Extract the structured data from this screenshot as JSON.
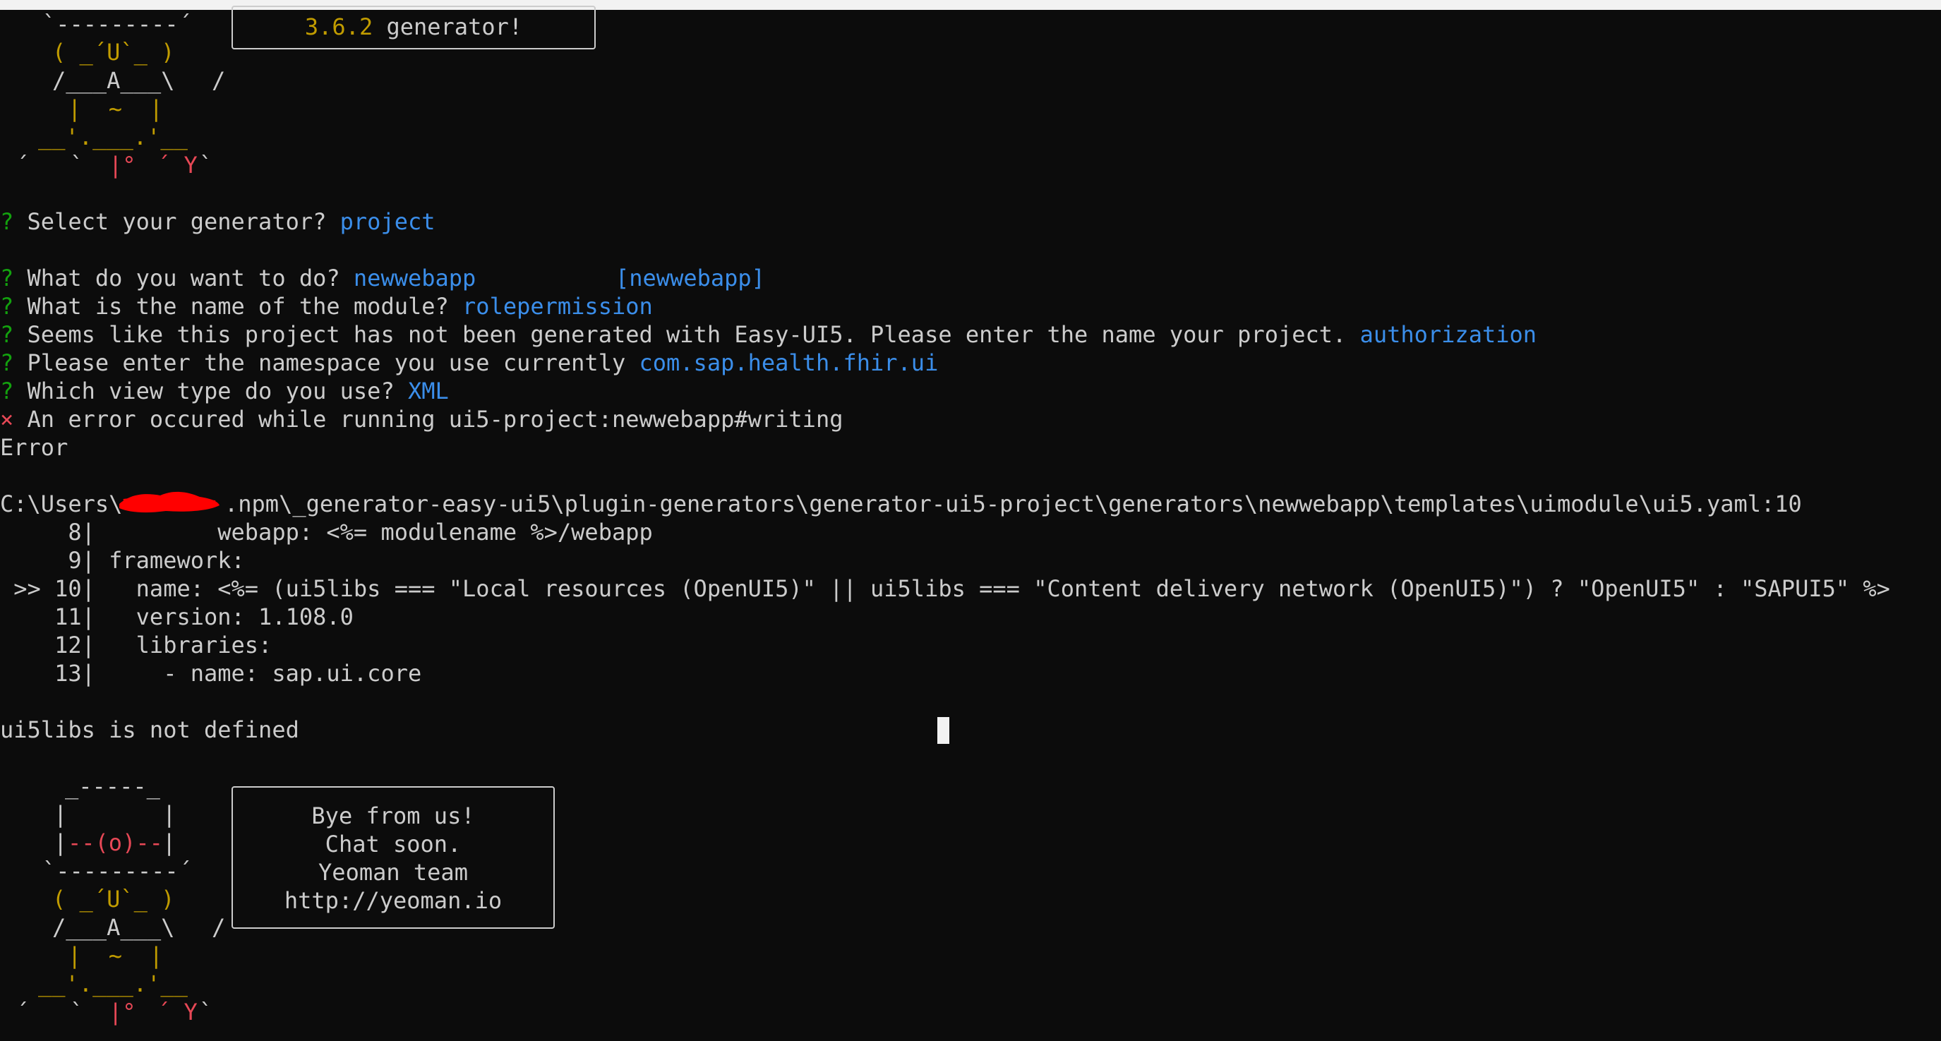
{
  "top_box": {
    "version": "3.6.2",
    "text": " generator!"
  },
  "yeoman_top": {
    "row1": "`---------´",
    "row2a": "( _´U`_ )",
    "row3a": "/___A___\\",
    "row3b": "/",
    "row4": "|  ~  |",
    "row5a": "__'.___.'__",
    "row6a": "´   `",
    "row6b": "|° ",
    "row6c": "´ Y ",
    "row6d": "`"
  },
  "prompts": [
    {
      "mark": "?",
      "question": " Select your generator? ",
      "answer": "project",
      "extra": ""
    },
    {
      "mark": "?",
      "question": " What do you want to do? ",
      "answer": "newwebapp",
      "extra": "[newwebapp]"
    },
    {
      "mark": "?",
      "question": " What is the name of the module? ",
      "answer": "rolepermission",
      "extra": ""
    },
    {
      "mark": "?",
      "question": " Seems like this project has not been generated with Easy-UI5. Please enter the name your project. ",
      "answer": "authorization",
      "extra": ""
    },
    {
      "mark": "?",
      "question": " Please enter the namespace you use currently ",
      "answer": "com.sap.health.fhir.ui",
      "extra": ""
    },
    {
      "mark": "?",
      "question": " Which view type do you use? ",
      "answer": "XML",
      "extra": ""
    }
  ],
  "error": {
    "mark": "×",
    "message": " An error occured while running ui5-project:newwebapp#writing",
    "label": "Error",
    "path_prefix": "C:\\Users\\",
    "path_rest": ".npm\\_generator-easy-ui5\\plugin-generators\\generator-ui5-project\\generators\\newwebapp\\templates\\uimodule\\ui5.yaml:10",
    "code_lines": [
      "     8|         webapp: <%= modulename %>/webapp",
      "     9| framework:",
      " >> 10|   name: <%= (ui5libs === \"Local resources (OpenUI5)\" || ui5libs === \"Content delivery network (OpenUI5)\") ? \"OpenUI5\" : \"SAPUI5\" %>",
      "    11|   version: 1.108.0",
      "    12|   libraries:",
      "    13|     - name: sap.ui.core"
    ],
    "detail": "ui5libs is not defined"
  },
  "yeoman_bottom": {
    "row0": "_-----_",
    "row1a": "|       |",
    "row2a": "|",
    "row2b": "--(o)--",
    "row2c": "|",
    "row3": "`---------´",
    "row4a": "( _´U`_ )",
    "row5a": "/___A___\\",
    "row5b": "/",
    "row6": "|  ~  |",
    "row7": "__'.___.'__",
    "row8a": "´   `",
    "row8b": "|° ",
    "row8c": "´ Y ",
    "row8d": "`"
  },
  "bye_box": {
    "line1": "Bye from us!",
    "line2": "Chat soon.",
    "line3": "Yeoman team",
    "line4": "http://yeoman.io"
  },
  "colors": {
    "background": "#0c0c0c",
    "text": "#cccccc",
    "prompt_mark": "#13a10e",
    "answer": "#3b8eea",
    "yeoman_yellow": "#c19c00",
    "yeoman_red": "#e74856",
    "redaction": "#ff0000"
  }
}
